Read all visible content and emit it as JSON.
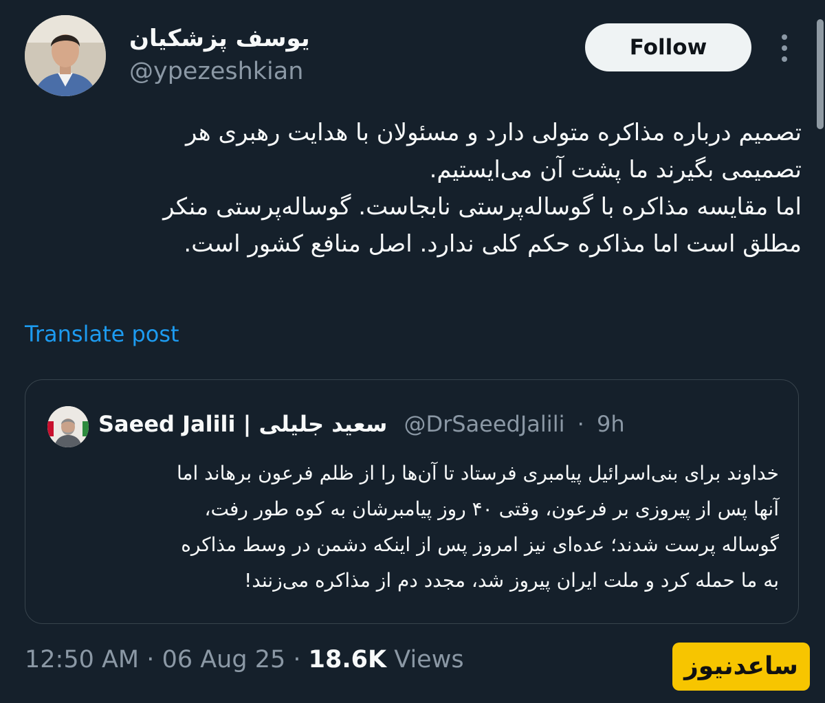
{
  "author": {
    "display_name": "یوسف پزشکیان",
    "handle": "@ypezeshkian"
  },
  "header": {
    "follow_label": "Follow",
    "more_icon": "more-vertical-icon"
  },
  "post": {
    "lines": [
      "تصمیم درباره مذاکره متولی دارد و مسئولان با هدایت رهبری هر",
      "تصمیمی بگیرند ما پشت آن می‌ایستیم.",
      "اما مقایسه مذاکره با گوساله‌پرستی نابجاست. گوساله‌پرستی منکر",
      "مطلق است اما مذاکره حکم کلی ندارد. اصل منافع کشور است."
    ],
    "translate_label": "Translate post"
  },
  "quote": {
    "name": "Saeed Jalili | سعید جلیلی",
    "handle": "@DrSaeedJalili",
    "separator": "·",
    "time": "9h",
    "lines": [
      "خداوند برای بنی‌اسرائیل پیامبری فرستاد تا آن‌ها را از ظلم فرعون برهاند اما",
      "آنها پس از پیروزی بر فرعون، وقتی ۴۰ روز پیامبرشان به کوه طور رفت،",
      "گوساله پرست شدند؛ عده‌ای نیز امروز پس از اینکه دشمن در وسط مذاکره",
      "به ما حمله کرد و ملت ایران پیروز شد، مجدد دم از مذاکره می‌زنند!"
    ]
  },
  "meta": {
    "time": "12:50 AM",
    "separator": "·",
    "date": "06 Aug 25",
    "views_count": "18.6K",
    "views_label": "Views"
  },
  "watermark": {
    "text": "ساعدنیوز"
  },
  "colors": {
    "background": "#15202b",
    "text": "#f7f9f9",
    "secondary_text": "#8b98a5",
    "link": "#1d9bf0",
    "border": "#38444d",
    "follow_bg": "#eff3f4",
    "watermark_bg": "#f7c500"
  }
}
